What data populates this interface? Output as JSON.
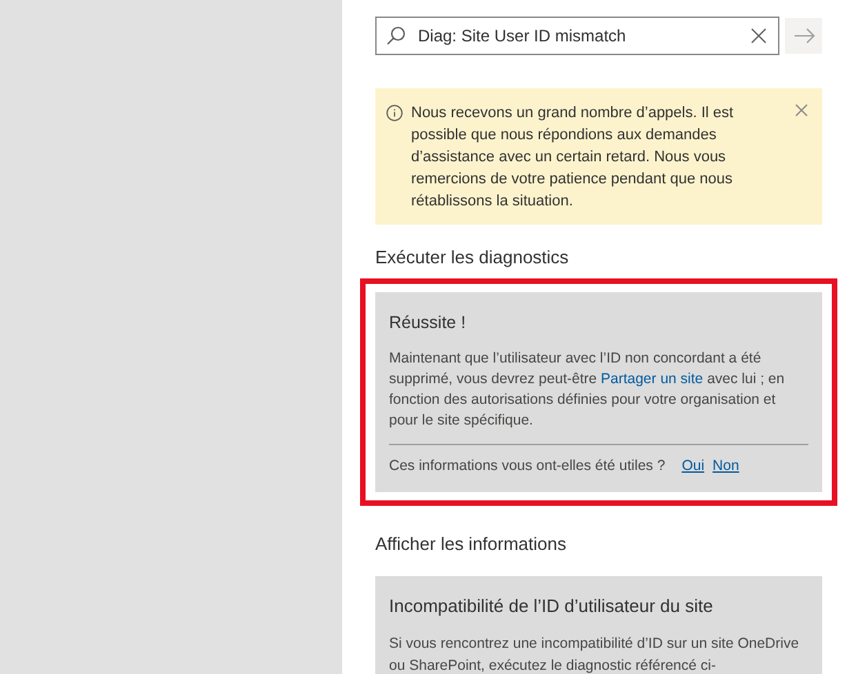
{
  "search": {
    "value": "Diag: Site User ID mismatch"
  },
  "banner": {
    "text": "Nous recevons un grand nombre d’appels. Il est possible que nous répondions aux demandes d’assistance avec un certain retard. Nous vous remercions de votre patience pendant que nous rétablissons la situation."
  },
  "run_diagnostics": {
    "heading": "Exécuter les diagnostics",
    "highlighted": true,
    "result": {
      "title": "Réussite !",
      "text_before": "Maintenant que l’utilisateur avec l’ID non concordant a été supprimé, vous devrez peut-être",
      "link": "Partager un site",
      "text_after": "avec lui ; en fonction des autorisations définies pour votre organisation et pour le site spécifique.",
      "feedback_question": "Ces informations vous ont-elles été utiles ?",
      "feedback_options": [
        "Oui",
        "Non"
      ]
    }
  },
  "view_info": {
    "heading": "Afficher les informations",
    "card": {
      "title": "Incompatibilité de l’ID d’utilisateur du site",
      "text": "Si vous rencontrez une incompatibilité d’ID sur un site OneDrive ou SharePoint, exécutez le diagnostic référencé ci-"
    }
  }
}
